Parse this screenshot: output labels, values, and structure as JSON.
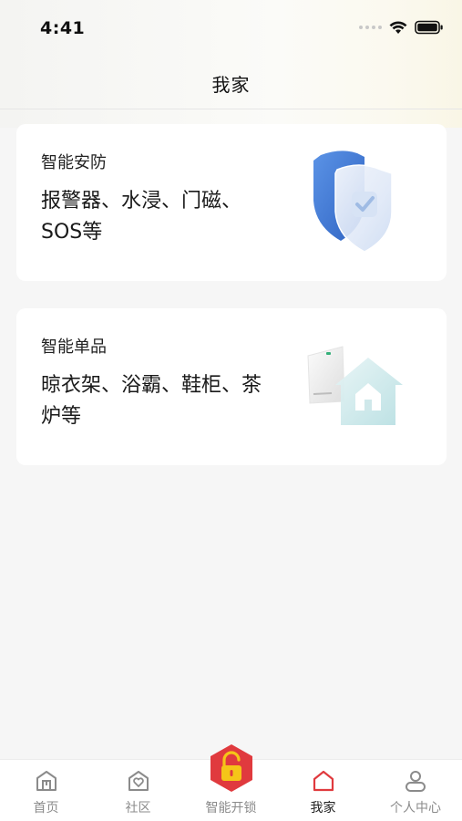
{
  "status_bar": {
    "time": "4:41"
  },
  "nav": {
    "title": "我家"
  },
  "cards": [
    {
      "title": "智能安防",
      "description": "报警器、水浸、门磁、SOS等",
      "icon": "shield-icon"
    },
    {
      "title": "智能单品",
      "description": "晾衣架、浴霸、鞋柜、茶炉等",
      "icon": "smart-home-device-icon"
    }
  ],
  "tabs": [
    {
      "label": "首页",
      "icon": "home-icon",
      "active": false
    },
    {
      "label": "社区",
      "icon": "community-icon",
      "active": false
    },
    {
      "label": "智能开锁",
      "icon": "lock-icon",
      "active": false
    },
    {
      "label": "我家",
      "icon": "house-icon",
      "active": true
    },
    {
      "label": "个人中心",
      "icon": "person-icon",
      "active": false
    }
  ],
  "colors": {
    "accent": "#e03a3e",
    "lock_icon": "#f5c518",
    "shield": "#3f7ed8",
    "house": "#bfe3e6"
  }
}
